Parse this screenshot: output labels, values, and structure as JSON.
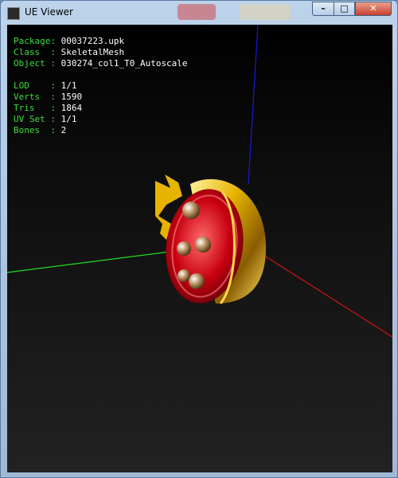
{
  "window": {
    "title": "UE Viewer"
  },
  "controls": {
    "minimize": "–",
    "maximize": "□",
    "close": "✕"
  },
  "info": {
    "package_label": "Package:",
    "package_value": "00037223.upk",
    "class_label": "Class  :",
    "class_value": "SkeletalMesh",
    "object_label": "Object :",
    "object_value": "030274_col1_T0_Autoscale",
    "lod_label": "LOD    :",
    "lod_value": "1/1",
    "verts_label": "Verts  :",
    "verts_value": "1590",
    "tris_label": "Tris   :",
    "tris_value": "1864",
    "uv_label": "UV Set :",
    "uv_value": "1/1",
    "bones_label": "Bones  :",
    "bones_value": "2"
  },
  "colors": {
    "axis_x": "#cc1414",
    "axis_y": "#22dd22",
    "axis_z": "#1a1ad8",
    "label_green": "#3fdd3f"
  }
}
